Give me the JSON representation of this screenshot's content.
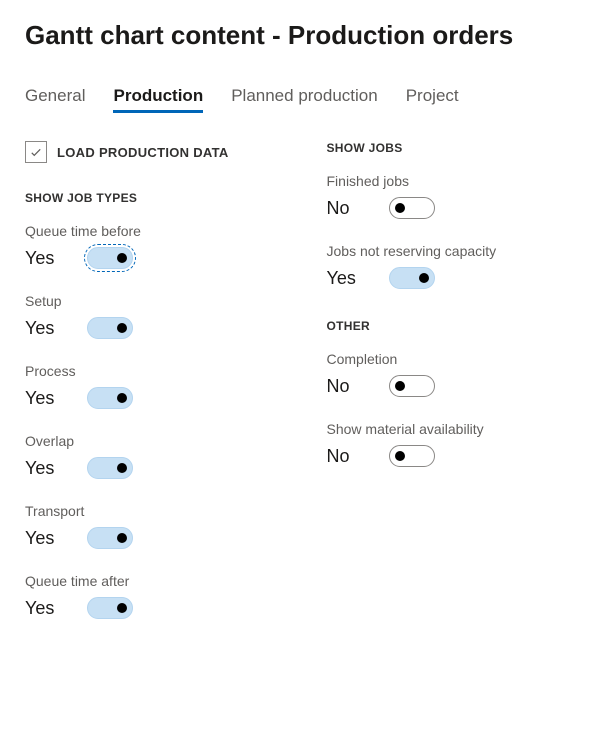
{
  "title": "Gantt chart content - Production orders",
  "tabs": {
    "general": "General",
    "production": "Production",
    "planned": "Planned production",
    "project": "Project"
  },
  "load_label": "LOAD PRODUCTION DATA",
  "sections": {
    "job_types": "SHOW JOB TYPES",
    "show_jobs": "SHOW JOBS",
    "other": "OTHER"
  },
  "left": {
    "queue_before": {
      "label": "Queue time before",
      "value": "Yes"
    },
    "setup": {
      "label": "Setup",
      "value": "Yes"
    },
    "process": {
      "label": "Process",
      "value": "Yes"
    },
    "overlap": {
      "label": "Overlap",
      "value": "Yes"
    },
    "transport": {
      "label": "Transport",
      "value": "Yes"
    },
    "queue_after": {
      "label": "Queue time after",
      "value": "Yes"
    }
  },
  "right": {
    "finished": {
      "label": "Finished jobs",
      "value": "No"
    },
    "not_reserving": {
      "label": "Jobs not reserving capacity",
      "value": "Yes"
    },
    "completion": {
      "label": "Completion",
      "value": "No"
    },
    "material": {
      "label": "Show material availability",
      "value": "No"
    }
  }
}
